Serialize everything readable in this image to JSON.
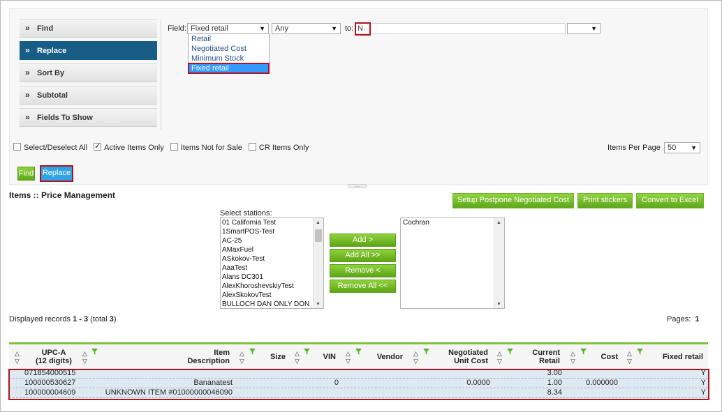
{
  "nav": {
    "items": [
      {
        "label": "Find"
      },
      {
        "label": "Replace"
      },
      {
        "label": "Sort By"
      },
      {
        "label": "Subtotal"
      },
      {
        "label": "Fields To Show"
      }
    ]
  },
  "find": {
    "field_label": "Field:",
    "field_value": "Fixed retail",
    "field_options": [
      "Retail",
      "Negotiated Cost",
      "Minimum Stock",
      "Fixed retail"
    ],
    "condition_value": "Any",
    "to_label": "to:",
    "to_value": "N"
  },
  "filters": {
    "select_all": "Select/Deselect All",
    "active_only": "Active Items Only",
    "not_for_sale": "Items Not for Sale",
    "cr_items": "CR Items Only",
    "items_per_page_label": "Items Per Page",
    "items_per_page_value": "50"
  },
  "actions": {
    "find": "Find",
    "replace": "Replace"
  },
  "page": {
    "title": "Items :: Price Management",
    "setup_postpone": "Setup Postpone Negotiated Cost",
    "print_stickers": "Print stickers",
    "convert_excel": "Convert to Excel"
  },
  "stations": {
    "label": "Select stations:",
    "available": [
      "01 California Test",
      "1SmartPOS-Test",
      "AC-25",
      "AMaxFuel",
      "ASkokov-Test",
      "AaaTest",
      "Alans DC301",
      "AlexKhoroshevskiyTest",
      "AlexSkokovTest",
      "BULLOCH DAN ONLY DON"
    ],
    "selected": [
      "Cochran"
    ],
    "add": "Add >",
    "add_all": "Add All >>",
    "remove": "Remove <",
    "remove_all": "Remove All <<"
  },
  "records": {
    "prefix": "Displayed records ",
    "range": "1 - 3",
    "total_prefix": " (total ",
    "total": "3",
    "total_suffix": ")",
    "pages_label": "Pages:",
    "pages_value": "1"
  },
  "table": {
    "columns": {
      "upc": "UPC-A\n(12 digits)",
      "desc": "Item\nDescription",
      "size": "Size",
      "vin": "VIN",
      "vendor": "Vendor",
      "negcost": "Negotiated\nUnit Cost",
      "curretail": "Current\nRetail",
      "cost": "Cost",
      "fixed": "Fixed retail"
    },
    "rows": [
      {
        "upc": "071854000515",
        "desc": "",
        "vin": "",
        "negcost": "",
        "curretail": "3.00",
        "cost": "",
        "fixed": "Y"
      },
      {
        "upc": "100000530627",
        "desc": "Bananatest",
        "vin": "0",
        "negcost": "0.0000",
        "curretail": "1.00",
        "cost": "0.000000",
        "fixed": "Y"
      },
      {
        "upc": "100000004609",
        "desc": "UNKNOWN ITEM #01000000046090",
        "vin": "",
        "negcost": "",
        "curretail": "8.34",
        "cost": "",
        "fixed": "Y"
      }
    ]
  },
  "colors": {
    "nav_active": "#175d86",
    "green": "#6ab42a",
    "blue_button": "#2ea3e6",
    "highlight": "#b0141c",
    "row_bg": "#dfe9f1"
  }
}
